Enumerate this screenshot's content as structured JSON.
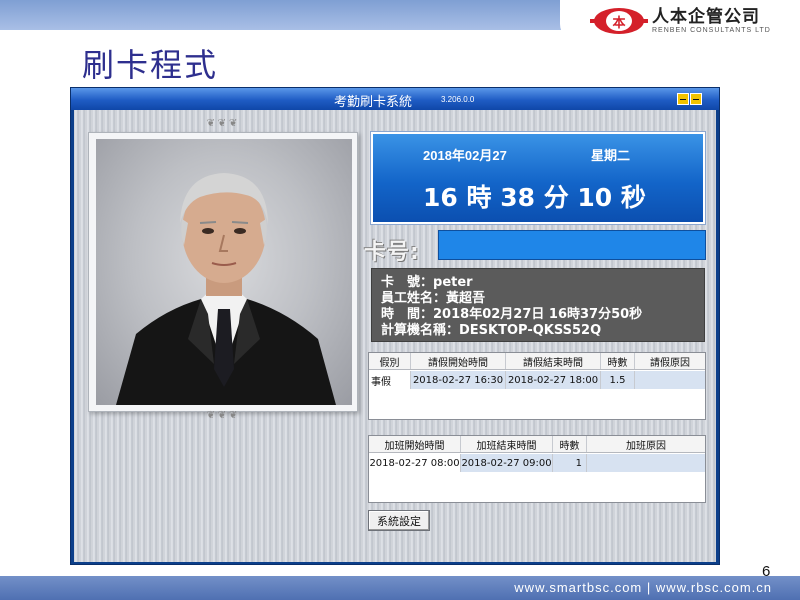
{
  "slide": {
    "title": "刷卡程式",
    "page_number": "6",
    "footer": "www.smartbsc.com  |  www.rbsc.com.cn"
  },
  "logo": {
    "mark": "本",
    "name_cn": "人本企管公司",
    "name_en": "RENBEN CONSULTANTS LTD"
  },
  "app": {
    "title": "考勤刷卡系統",
    "version": "3.206.0.0",
    "clock": {
      "date": "2018年02月27",
      "weekday": "星期二",
      "time": "16 時 38 分 10 秒"
    },
    "card": {
      "label": "卡号:",
      "value": ""
    },
    "info": {
      "card_no_label": "卡　號：",
      "card_no": "peter",
      "name_label": "員工姓名：",
      "name": "黃超吾",
      "time_label": "時　間：",
      "time": "2018年02月27日 16時37分50秒",
      "computer_label": "計算機名稱：",
      "computer": "DESKTOP-QKSS52Q"
    },
    "leave_table": {
      "headers": [
        "假別",
        "請假開始時間",
        "請假結束時間",
        "時數",
        "請假原因"
      ],
      "rows": [
        [
          "事假",
          "2018-02-27 16:30",
          "2018-02-27 18:00",
          "1.5",
          ""
        ]
      ]
    },
    "overtime_table": {
      "headers": [
        "加班開始時間",
        "加班結束時間",
        "時數",
        "加班原因"
      ],
      "rows": [
        [
          "2018-02-27 08:00",
          "2018-02-27 09:00",
          "1",
          ""
        ]
      ]
    },
    "settings_button": "系統設定"
  },
  "colors": {
    "title_blue": "#2e2f8e",
    "clock_blue": "#1365c9",
    "card_input": "#1f86e8",
    "info_panel": "#5b5b5b",
    "logo_red": "#d4202a"
  }
}
